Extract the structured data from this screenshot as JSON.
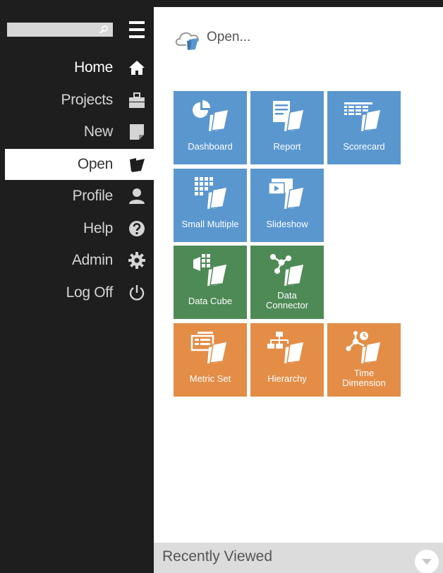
{
  "sidebar": {
    "search": {
      "value": "",
      "icon": "search-icon"
    },
    "menu_icon": "hamburger-menu-icon",
    "items": [
      {
        "label": "Home",
        "icon": "home-icon"
      },
      {
        "label": "Projects",
        "icon": "briefcase-icon"
      },
      {
        "label": "New",
        "icon": "new-document-icon"
      },
      {
        "label": "Open",
        "icon": "open-folder-icon",
        "active": true
      },
      {
        "label": "Profile",
        "icon": "user-icon"
      },
      {
        "label": "Help",
        "icon": "help-icon"
      },
      {
        "label": "Admin",
        "icon": "gear-icon"
      },
      {
        "label": "Log Off",
        "icon": "power-icon"
      }
    ]
  },
  "main": {
    "title": "Open...",
    "title_icon": "cloud-open-icon",
    "tiles": [
      {
        "label": "Dashboard",
        "color": "#5a97cf",
        "icon": "dashboard-open-icon"
      },
      {
        "label": "Report",
        "color": "#5a97cf",
        "icon": "report-open-icon"
      },
      {
        "label": "Scorecard",
        "color": "#5a97cf",
        "icon": "scorecard-open-icon"
      },
      {
        "label": "Small Multiple",
        "color": "#5a97cf",
        "icon": "small-multiple-open-icon"
      },
      {
        "label": "Slideshow",
        "color": "#5a97cf",
        "icon": "slideshow-open-icon"
      },
      {
        "label": "Data Cube",
        "color": "#4e8a55",
        "icon": "data-cube-open-icon"
      },
      {
        "label": "Data Connector",
        "color": "#4e8a55",
        "icon": "data-connector-open-icon"
      },
      {
        "label": "Metric Set",
        "color": "#e38d47",
        "icon": "metric-set-open-icon"
      },
      {
        "label": "Hierarchy",
        "color": "#e38d47",
        "icon": "hierarchy-open-icon"
      },
      {
        "label": "Time Dimension",
        "color": "#e38d47",
        "icon": "time-dimension-open-icon"
      }
    ],
    "recent": {
      "label": "Recently Viewed",
      "toggle_icon": "chevron-down-icon"
    }
  }
}
